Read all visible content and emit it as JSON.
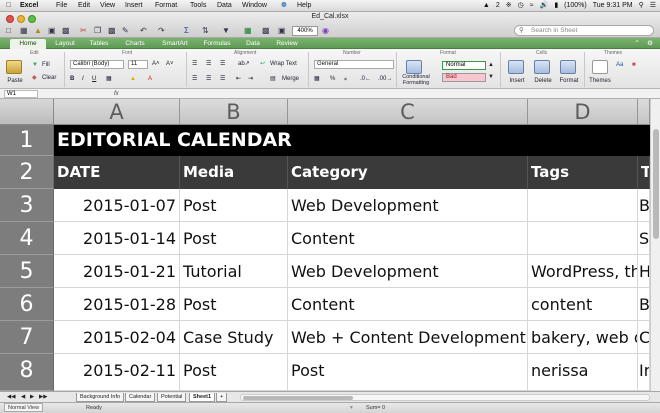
{
  "menubar": {
    "apple": "",
    "app": "Excel",
    "items": [
      "File",
      "Edit",
      "View",
      "Insert",
      "Format",
      "Tools",
      "Data",
      "Window",
      "Help"
    ],
    "right": {
      "battery": "(100%)",
      "time": "Tue 9:31 PM",
      "badge": "2"
    }
  },
  "window": {
    "title": "Ed_Cal.xlsx",
    "zoom": "400%",
    "search_placeholder": "Search in Sheet"
  },
  "ribbon": {
    "tabs": [
      "Home",
      "Layout",
      "Tables",
      "Charts",
      "SmartArt",
      "Formulas",
      "Data",
      "Review"
    ],
    "active_tab": "Home",
    "groups": [
      "Edit",
      "Font",
      "Alignment",
      "Number",
      "Format",
      "Cells",
      "Themes"
    ],
    "paste": "Paste",
    "fill": "Fill",
    "clear": "Clear",
    "font_name": "Calibri (Body)",
    "font_size": "11",
    "wrap_text": "Wrap Text",
    "merge": "Merge",
    "number_format": "General",
    "conditional": "Conditional Formatting",
    "style_normal": "Normal",
    "style_bad": "Bad",
    "insert": "Insert",
    "delete": "Delete",
    "format": "Format",
    "themes": "Themes"
  },
  "formula_bar": {
    "name_box": "W1",
    "fx": "fx",
    "value": ""
  },
  "columns": [
    "A",
    "B",
    "C",
    "D"
  ],
  "rows": [
    "1",
    "2",
    "3",
    "4",
    "5",
    "6",
    "7",
    "8"
  ],
  "sheet": {
    "title": "EDITORIAL CALENDAR",
    "headers": [
      "DATE",
      "Media",
      "Category",
      "Tags",
      "T"
    ],
    "data": [
      [
        "2015-01-07",
        "Post",
        "Web Development",
        "",
        "B"
      ],
      [
        "2015-01-14",
        "Post",
        "Content",
        "",
        "Si"
      ],
      [
        "2015-01-21",
        "Tutorial",
        "Web Development",
        "WordPress, th",
        "H"
      ],
      [
        "2015-01-28",
        "Post",
        "Content",
        "content",
        "B"
      ],
      [
        "2015-02-04",
        "Case Study",
        "Web + Content Development",
        "bakery, web d",
        "C"
      ],
      [
        "2015-02-11",
        "Post",
        "Post",
        "nerissa",
        "Ir"
      ]
    ]
  },
  "sheet_tabs": [
    "Background Info",
    "Calendar",
    "Potential",
    "Sheet1",
    "+"
  ],
  "active_sheet": "Sheet1",
  "statusbar": {
    "view": "Normal View",
    "status": "Ready",
    "sum": "Sum= 0"
  }
}
